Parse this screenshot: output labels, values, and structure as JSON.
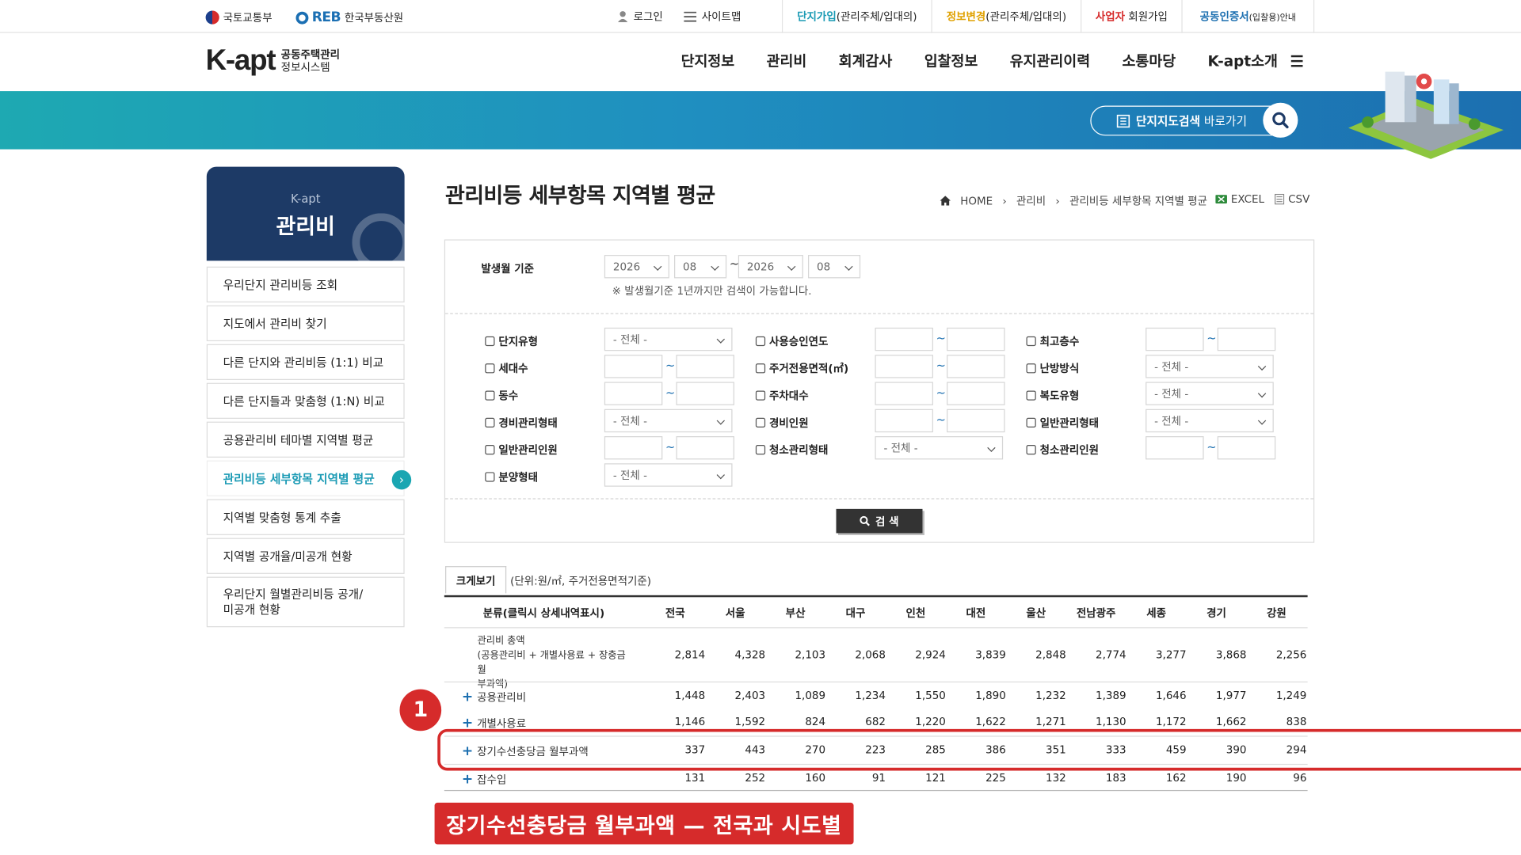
{
  "utility": {
    "molit": "국토교통부",
    "reb_logo": "REB",
    "reb_name": "한국부동산원",
    "login": "로그인",
    "sitemap": "사이트맵",
    "links": [
      {
        "strong": "단지가입",
        "rest": "(관리주체/입대의)",
        "color": "#1c9bb5"
      },
      {
        "strong": "정보변경",
        "rest": "(관리주체/입대의)",
        "color": "#e0a100"
      },
      {
        "strong": "사업자",
        "rest": " 회원가입",
        "color": "#d62b2b"
      },
      {
        "strong": "공동인증서",
        "rest": "(입찰용)안내",
        "color": "#1c6fb0"
      }
    ]
  },
  "header": {
    "logo_main": "K-apt",
    "logo_sub1": "공동주택관리",
    "logo_sub2": "정보시스템",
    "nav": [
      "단지정보",
      "관리비",
      "회계감사",
      "입찰정보",
      "유지관리이력",
      "소통마당",
      "K-apt소개"
    ]
  },
  "banner": {
    "map_search_bold": "단지지도검색",
    "map_search_rest": "바로가기"
  },
  "sidebar": {
    "head_small": "K-apt",
    "head_title": "관리비",
    "items": [
      {
        "label": "우리단지 관리비등 조회"
      },
      {
        "label": "지도에서 관리비 찾기"
      },
      {
        "label": "다른 단지와 관리비등 (1:1) 비교"
      },
      {
        "label": "다른 단지들과 맞춤형 (1:N) 비교"
      },
      {
        "label": "공용관리비 테마별 지역별 평균"
      },
      {
        "label": "관리비등 세부항목 지역별 평균"
      },
      {
        "label": "지역별 맞춤형 통계 추출"
      },
      {
        "label": "지역별 공개율/미공개 현황"
      },
      {
        "label": "우리단지 월별관리비등 공개/"
      },
      {
        "label": "미공개 현황"
      }
    ]
  },
  "page": {
    "title": "관리비등 세부항목 지역별 평균",
    "breadcrumb": [
      "HOME",
      "관리비",
      "관리비등 세부항목 지역별 평균"
    ],
    "excel": "EXCEL",
    "csv": "CSV"
  },
  "form": {
    "date_label": "발생월 기준",
    "from_year": "2026",
    "from_month": "08",
    "to_year": "2026",
    "to_month": "08",
    "tilde": "~",
    "note": "※ 발생월기준 1년까지만 검색이 가능합니다.",
    "all_option": "- 전체 -",
    "filters": [
      "단지유형",
      "세대수",
      "동수",
      "경비관리형태",
      "일반관리인원",
      "분양형태",
      "사용승인연도",
      "주거전용면적(㎡)",
      "주차대수",
      "경비인원",
      "청소관리형태",
      "최고층수",
      "난방방식",
      "복도유형",
      "일반관리형태",
      "청소관리인원"
    ],
    "search_button": "검 색"
  },
  "table": {
    "big_view": "크게보기",
    "unit_note": "(단위:원/㎡, 주거전용면적기준)",
    "columns": [
      "분류(클릭시 상세내역표시)",
      "전국",
      "서울",
      "부산",
      "대구",
      "인천",
      "대전",
      "울산",
      "전남광주",
      "세종",
      "경기",
      "강원"
    ],
    "total_label_1": "관리비 총액",
    "total_label_2": "(공용관리비 + 개별사용료 + 장충금 월",
    "total_label_3": "부과액)",
    "rows": [
      {
        "label": "관리비 총액",
        "values": [
          "2,814",
          "4,328",
          "2,103",
          "2,068",
          "2,924",
          "3,839",
          "2,848",
          "2,774",
          "3,277",
          "3,868",
          "2,256"
        ]
      },
      {
        "label": "공용관리비",
        "values": [
          "1,448",
          "2,403",
          "1,089",
          "1,234",
          "1,550",
          "1,890",
          "1,232",
          "1,389",
          "1,646",
          "1,977",
          "1,249"
        ]
      },
      {
        "label": "개별사용료",
        "values": [
          "1,146",
          "1,592",
          "824",
          "682",
          "1,220",
          "1,622",
          "1,271",
          "1,130",
          "1,172",
          "1,662",
          "838"
        ]
      },
      {
        "label": "장기수선충당금 월부과액",
        "values": [
          "337",
          "443",
          "270",
          "223",
          "285",
          "386",
          "351",
          "333",
          "459",
          "390",
          "294"
        ]
      },
      {
        "label": "잡수입",
        "values": [
          "131",
          "252",
          "160",
          "91",
          "121",
          "225",
          "132",
          "183",
          "162",
          "190",
          "96"
        ]
      }
    ]
  },
  "annotation": {
    "badge": "1",
    "caption": "장기수선충당금 월부과액 — 전국과 시도별",
    "color": "#d62b2b"
  }
}
